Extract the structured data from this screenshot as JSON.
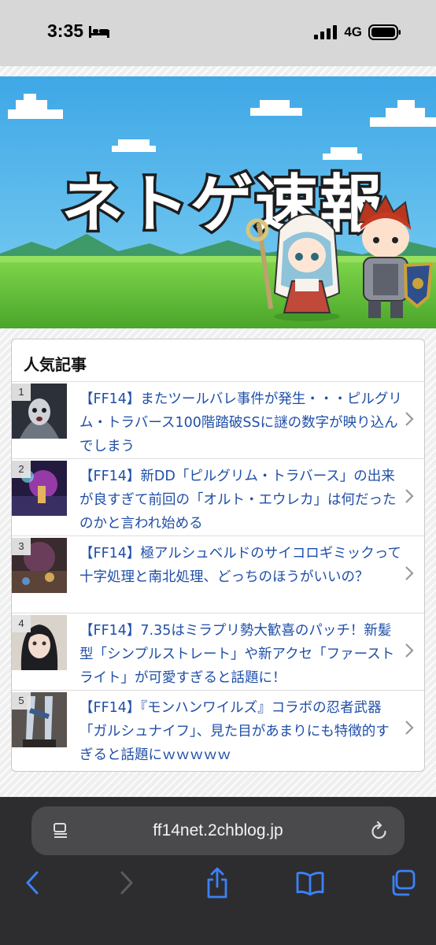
{
  "status_bar": {
    "time": "3:35",
    "network": "4G",
    "sleep_icon": "bed-icon",
    "signal_icon": "cellular-signal-icon",
    "battery_icon": "battery-icon"
  },
  "banner": {
    "title": "ネトゲ速報"
  },
  "popular": {
    "heading": "人気記事",
    "items": [
      {
        "rank": "1",
        "title": "【FF14】またツールバレ事件が発生・・・ピルグリム・トラバース100階踏破SSに謎の数字が映り込んでしまう"
      },
      {
        "rank": "2",
        "title": "【FF14】新DD「ピルグリム・トラバース」の出来が良すぎて前回の「オルト・エウレカ」は何だったのかと言われ始める"
      },
      {
        "rank": "3",
        "title": "【FF14】極アルシュベルドのサイコロギミックって十字処理と南北処理、どっちのほうがいいの？"
      },
      {
        "rank": "4",
        "title": "【FF14】7.35はミラプリ勢大歓喜のパッチ！新髪型「シンプルストレート」や新アクセ「ファーストライト」が可愛すぎると話題に！"
      },
      {
        "rank": "5",
        "title": "【FF14】『モンハンワイルズ』コラボの忍者武器「ガルシュナイフ」、見た目があまりにも特徴的すぎると話題にｗｗｗｗｗ"
      }
    ]
  },
  "browser": {
    "url": "ff14net.2chblog.jp",
    "page_menu_icon": "page-menu-icon",
    "reload_icon": "reload-icon",
    "toolbar": [
      "back-icon",
      "forward-icon",
      "share-icon",
      "bookmarks-icon",
      "tabs-icon"
    ]
  },
  "colors": {
    "link": "#1f4fa8",
    "accent": "#2f7bf5",
    "browser_bg": "#2d2d2f"
  }
}
